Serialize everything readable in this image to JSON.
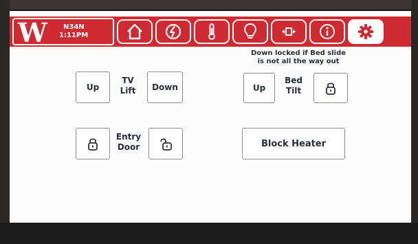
{
  "header": {
    "logo_text": "W",
    "unit_id": "N34N",
    "time": "1:11PM",
    "nav_icons": [
      "home-icon",
      "power-icon",
      "thermometer-icon",
      "lightbulb-icon",
      "slide-out-icon",
      "info-icon",
      "gear-icon"
    ],
    "active_icon": "gear-icon",
    "accent_color": "#cf2a31"
  },
  "note": {
    "line1": "Down locked if Bed slide",
    "line2": "is not all the way out"
  },
  "tv_lift": {
    "up_label": "Up",
    "title_line1": "TV",
    "title_line2": "Lift",
    "down_label": "Down"
  },
  "bed_tilt": {
    "up_label": "Up",
    "title_line1": "Bed",
    "title_line2": "Tilt",
    "lock_icon": "lock-icon"
  },
  "entry_door": {
    "lock_icon": "lock-icon",
    "title_line1": "Entry",
    "title_line2": "Door",
    "unlock_icon": "unlock-icon"
  },
  "block_heater": {
    "label": "Block Heater"
  }
}
